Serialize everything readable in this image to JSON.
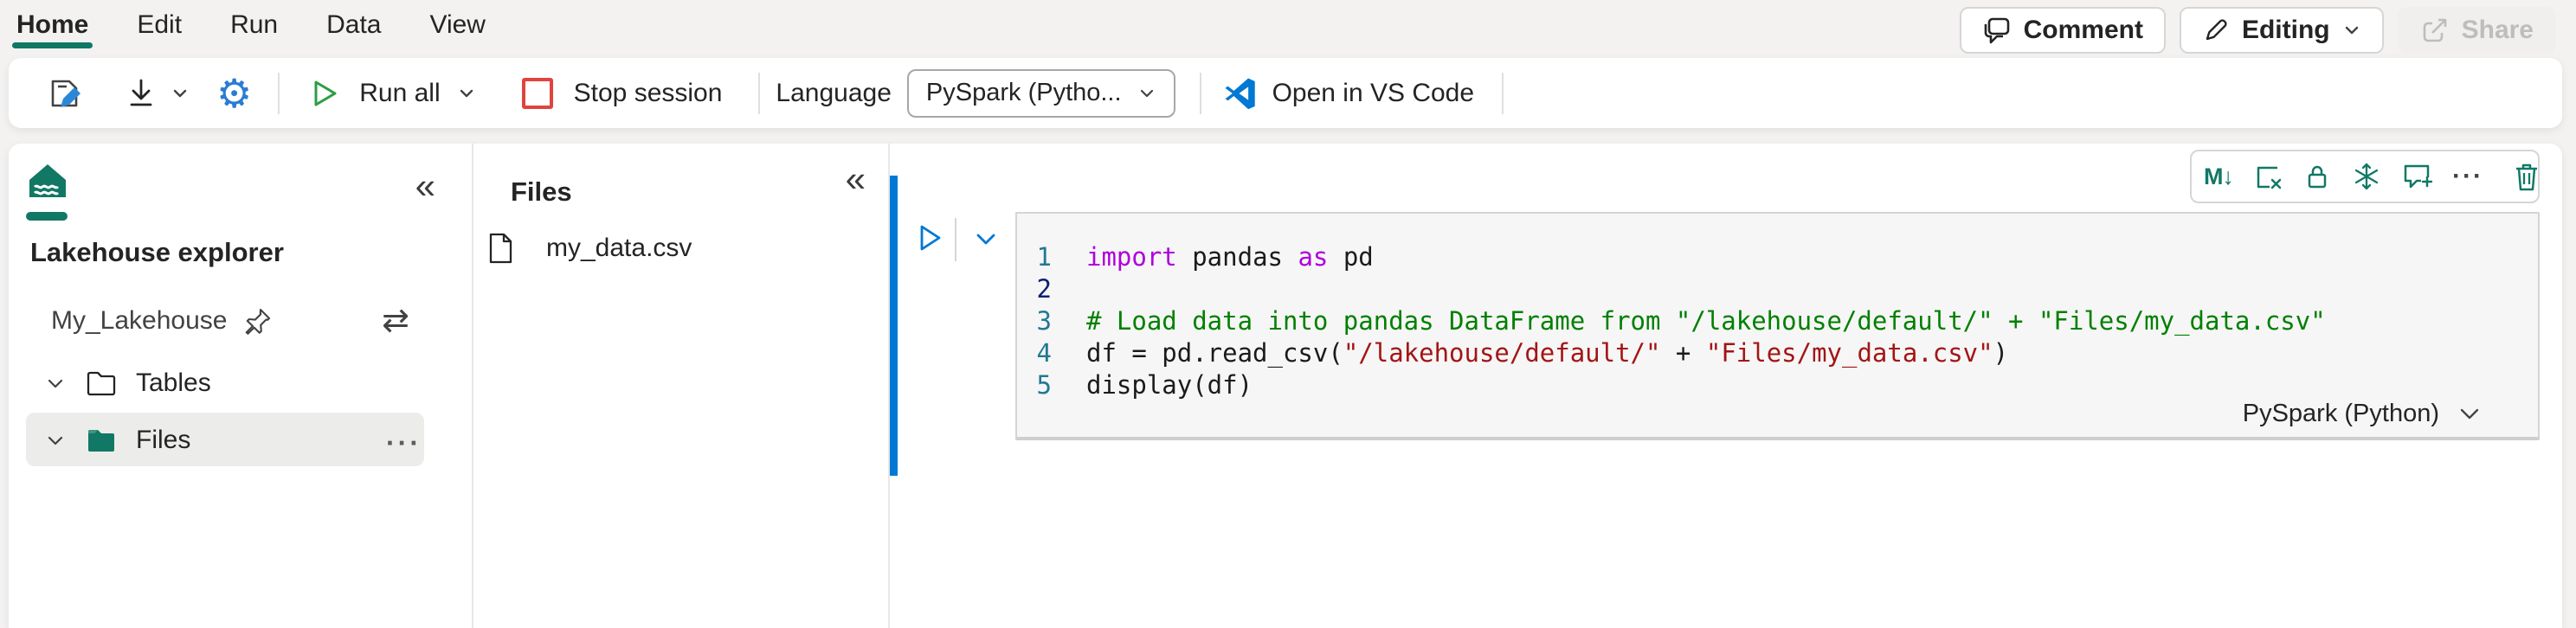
{
  "menu": {
    "items": [
      {
        "label": "Home",
        "active": true
      },
      {
        "label": "Edit",
        "active": false
      },
      {
        "label": "Run",
        "active": false
      },
      {
        "label": "Data",
        "active": false
      },
      {
        "label": "View",
        "active": false
      }
    ]
  },
  "top_actions": {
    "comment_label": "Comment",
    "editing_label": "Editing",
    "share_label": "Share",
    "share_disabled": true
  },
  "toolbar": {
    "run_all_label": "Run all",
    "stop_session_label": "Stop session",
    "language_label": "Language",
    "language_value": "PySpark (Pytho...",
    "open_vscode_label": "Open in VS Code"
  },
  "explorer": {
    "collapse_glyph": "«",
    "title": "Lakehouse explorer",
    "lakehouse_name": "My_Lakehouse",
    "swap_glyph": "⇄",
    "tree": {
      "tables_label": "Tables",
      "files_label": "Files",
      "files_selected": true,
      "more_glyph": "···"
    }
  },
  "files_panel": {
    "collapse_glyph": "«",
    "title": "Files",
    "file_name": "my_data.csv"
  },
  "cell_toolbar": {
    "markdown_glyph": "M↓",
    "more_glyph": "···",
    "icons": [
      "convert-to-markdown",
      "clear-output",
      "lock-cell",
      "freeze-cell",
      "add-comment",
      "more-options",
      "delete-cell"
    ]
  },
  "cell": {
    "kernel_label": "PySpark (Python)",
    "lines": [
      {
        "n": "1",
        "active": false,
        "tokens": [
          {
            "t": "kw",
            "v": "import"
          },
          {
            "t": "tx",
            "v": " pandas "
          },
          {
            "t": "kw",
            "v": "as"
          },
          {
            "t": "tx",
            "v": " pd"
          }
        ]
      },
      {
        "n": "2",
        "active": true,
        "tokens": []
      },
      {
        "n": "3",
        "active": false,
        "tokens": [
          {
            "t": "cm",
            "v": "# Load data into pandas DataFrame from \"/lakehouse/default/\" + \"Files/my_data.csv\""
          }
        ]
      },
      {
        "n": "4",
        "active": false,
        "tokens": [
          {
            "t": "tx",
            "v": "df = pd.read_csv("
          },
          {
            "t": "st",
            "v": "\"/lakehouse/default/\""
          },
          {
            "t": "tx",
            "v": " + "
          },
          {
            "t": "st",
            "v": "\"Files/my_data.csv\""
          },
          {
            "t": "tx",
            "v": ")"
          }
        ]
      },
      {
        "n": "5",
        "active": false,
        "tokens": [
          {
            "t": "tx",
            "v": "display(df)"
          }
        ]
      }
    ]
  },
  "colors": {
    "accent_teal": "#117865",
    "accent_blue": "#0078d4",
    "run_green": "#2d9e44",
    "stop_red": "#e0443e",
    "code_keyword": "#af00db",
    "code_comment": "#008000",
    "code_string": "#a31515",
    "line_number": "#237893",
    "line_number_active": "#0b216f"
  }
}
